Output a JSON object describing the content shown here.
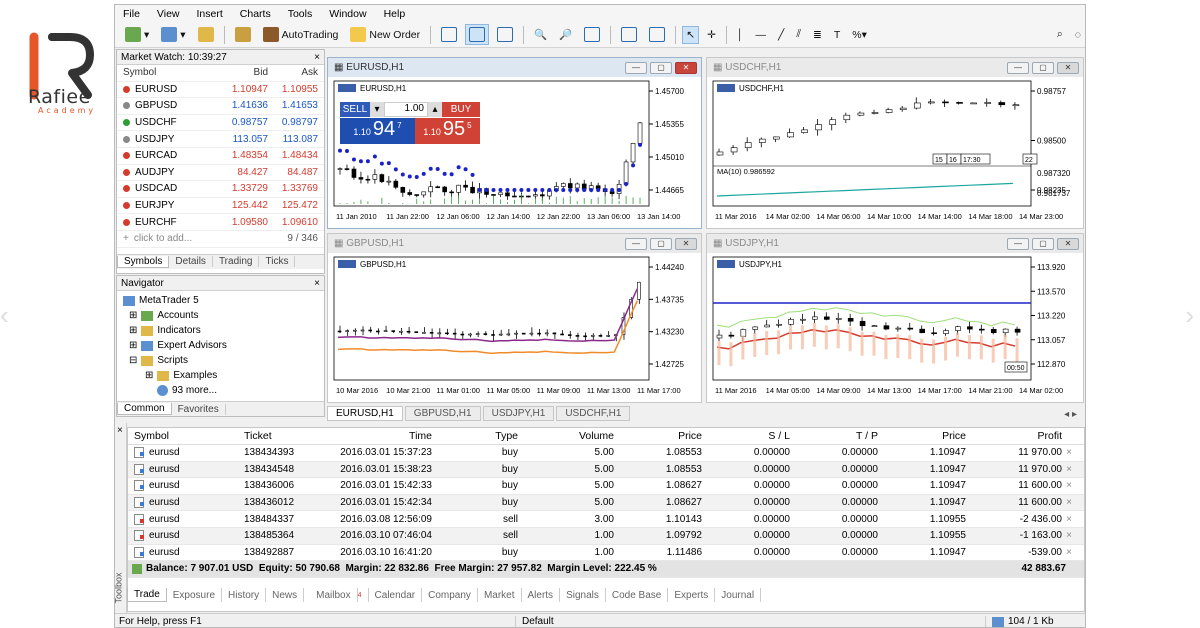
{
  "brand": {
    "name": "Rafiee",
    "sub": "Academy"
  },
  "menu": [
    "File",
    "View",
    "Insert",
    "Charts",
    "Tools",
    "Window",
    "Help"
  ],
  "toolbar": {
    "autotrading": "AutoTrading",
    "new_order": "New Order"
  },
  "market_watch": {
    "title": "Market Watch: 10:39:27",
    "cols": [
      "Symbol",
      "Bid",
      "Ask"
    ],
    "rows": [
      {
        "s": "EURUSD",
        "b": "1.10947",
        "a": "1.10955",
        "dir": "down"
      },
      {
        "s": "GBPUSD",
        "b": "1.41636",
        "a": "1.41653",
        "dir": "flat"
      },
      {
        "s": "USDCHF",
        "b": "0.98757",
        "a": "0.98797",
        "dir": "up"
      },
      {
        "s": "USDJPY",
        "b": "113.057",
        "a": "113.087",
        "dir": "flat"
      },
      {
        "s": "EURCAD",
        "b": "1.48354",
        "a": "1.48434",
        "dir": "down"
      },
      {
        "s": "AUDJPY",
        "b": "84.427",
        "a": "84.487",
        "dir": "down"
      },
      {
        "s": "USDCAD",
        "b": "1.33729",
        "a": "1.33769",
        "dir": "down"
      },
      {
        "s": "EURJPY",
        "b": "125.442",
        "a": "125.472",
        "dir": "down"
      },
      {
        "s": "EURCHF",
        "b": "1.09580",
        "a": "1.09610",
        "dir": "down"
      }
    ],
    "add": "click to add...",
    "count": "9 / 346",
    "tabs": [
      "Symbols",
      "Details",
      "Trading",
      "Ticks"
    ]
  },
  "navigator": {
    "title": "Navigator",
    "root": "MetaTrader 5",
    "items": [
      "Accounts",
      "Indicators",
      "Expert Advisors",
      "Scripts"
    ],
    "sub": [
      "Examples",
      "93 more..."
    ],
    "tabs": [
      "Common",
      "Favorites"
    ]
  },
  "charts": [
    {
      "title": "EURUSD,H1",
      "label": "EURUSD,H1",
      "prices": [
        "1.45700",
        "1.45355",
        "1.45010",
        "1.44665"
      ],
      "times": [
        "11 Jan 2010",
        "11 Jan 22:00",
        "12 Jan 06:00",
        "12 Jan 14:00",
        "12 Jan 22:00",
        "13 Jan 06:00",
        "13 Jan 14:00"
      ]
    },
    {
      "title": "USDCHF,H1",
      "label": "USDCHF,H1",
      "prices": [
        "0.98757",
        "0.98500",
        "0.98235"
      ],
      "ma": "MA(10) 0.986592",
      "ma_prices": [
        "0.987320",
        "0.981737"
      ],
      "times": [
        "11 Mar 2016",
        "14 Mar 02:00",
        "14 Mar 06:00",
        "14 Mar 10:00",
        "14 Mar 14:00",
        "14 Mar 18:00",
        "14 Mar 23:00"
      ],
      "tags": [
        "15",
        "16",
        "17:30",
        "22"
      ]
    },
    {
      "title": "GBPUSD,H1",
      "label": "GBPUSD,H1",
      "prices": [
        "1.44240",
        "1.43735",
        "1.43230",
        "1.42725"
      ],
      "times": [
        "10 Mar 2016",
        "10 Mar 21:00",
        "11 Mar 01:00",
        "11 Mar 05:00",
        "11 Mar 09:00",
        "11 Mar 13:00",
        "11 Mar 17:00"
      ]
    },
    {
      "title": "USDJPY,H1",
      "label": "USDJPY,H1",
      "prices": [
        "113.920",
        "113.570",
        "113.220",
        "113.057",
        "112.870"
      ],
      "times": [
        "11 Mar 2016",
        "14 Mar 05:00",
        "14 Mar 09:00",
        "14 Mar 13:00",
        "14 Mar 17:00",
        "14 Mar 21:00",
        "14 Mar 02:00"
      ],
      "tag": "00:50"
    }
  ],
  "trade_panel": {
    "sell": "SELL",
    "buy": "BUY",
    "volume": "1.00",
    "sell_big": "94",
    "sell_pre": "1.10",
    "sell_sup": "7",
    "buy_big": "95",
    "buy_pre": "1.10",
    "buy_sup": "5"
  },
  "doc_tabs": [
    "EURUSD,H1",
    "GBPUSD,H1",
    "USDJPY,H1",
    "USDCHF,H1"
  ],
  "trade": {
    "cols": [
      "Symbol",
      "Ticket",
      "Time",
      "Type",
      "Volume",
      "Price",
      "S / L",
      "T / P",
      "Price",
      "Profit"
    ],
    "rows": [
      {
        "sym": "eurusd",
        "ticket": "138434393",
        "time": "2016.03.01 15:37:23",
        "type": "buy",
        "vol": "5.00",
        "price": "1.08553",
        "sl": "0.00000",
        "tp": "0.00000",
        "cur": "1.10947",
        "profit": "11 970.00"
      },
      {
        "sym": "eurusd",
        "ticket": "138434548",
        "time": "2016.03.01 15:38:23",
        "type": "buy",
        "vol": "5.00",
        "price": "1.08553",
        "sl": "0.00000",
        "tp": "0.00000",
        "cur": "1.10947",
        "profit": "11 970.00"
      },
      {
        "sym": "eurusd",
        "ticket": "138436006",
        "time": "2016.03.01 15:42:33",
        "type": "buy",
        "vol": "5.00",
        "price": "1.08627",
        "sl": "0.00000",
        "tp": "0.00000",
        "cur": "1.10947",
        "profit": "11 600.00"
      },
      {
        "sym": "eurusd",
        "ticket": "138436012",
        "time": "2016.03.01 15:42:34",
        "type": "buy",
        "vol": "5.00",
        "price": "1.08627",
        "sl": "0.00000",
        "tp": "0.00000",
        "cur": "1.10947",
        "profit": "11 600.00"
      },
      {
        "sym": "eurusd",
        "ticket": "138484337",
        "time": "2016.03.08 12:56:09",
        "type": "sell",
        "vol": "3.00",
        "price": "1.10143",
        "sl": "0.00000",
        "tp": "0.00000",
        "cur": "1.10955",
        "profit": "-2 436.00"
      },
      {
        "sym": "eurusd",
        "ticket": "138485364",
        "time": "2016.03.10 07:46:04",
        "type": "sell",
        "vol": "1.00",
        "price": "1.09792",
        "sl": "0.00000",
        "tp": "0.00000",
        "cur": "1.10955",
        "profit": "-1 163.00"
      },
      {
        "sym": "eurusd",
        "ticket": "138492887",
        "time": "2016.03.10 16:41:20",
        "type": "buy",
        "vol": "1.00",
        "price": "1.11486",
        "sl": "0.00000",
        "tp": "0.00000",
        "cur": "1.10947",
        "profit": "-539.00"
      }
    ],
    "balance": "Balance: 7 907.01 USD  Equity: 50 790.68  Margin: 22 832.86  Free Margin: 27 957.82  Margin Level: 222.45 %",
    "total": "42 883.67",
    "tabs": [
      "Trade",
      "Exposure",
      "History",
      "News",
      "Mailbox",
      "Calendar",
      "Company",
      "Market",
      "Alerts",
      "Signals",
      "Code Base",
      "Experts",
      "Journal"
    ],
    "mailbox_count": "4",
    "side": "Toolbox"
  },
  "status": {
    "help": "For Help, press F1",
    "profile": "Default",
    "traffic": "104 / 1 Kb"
  }
}
